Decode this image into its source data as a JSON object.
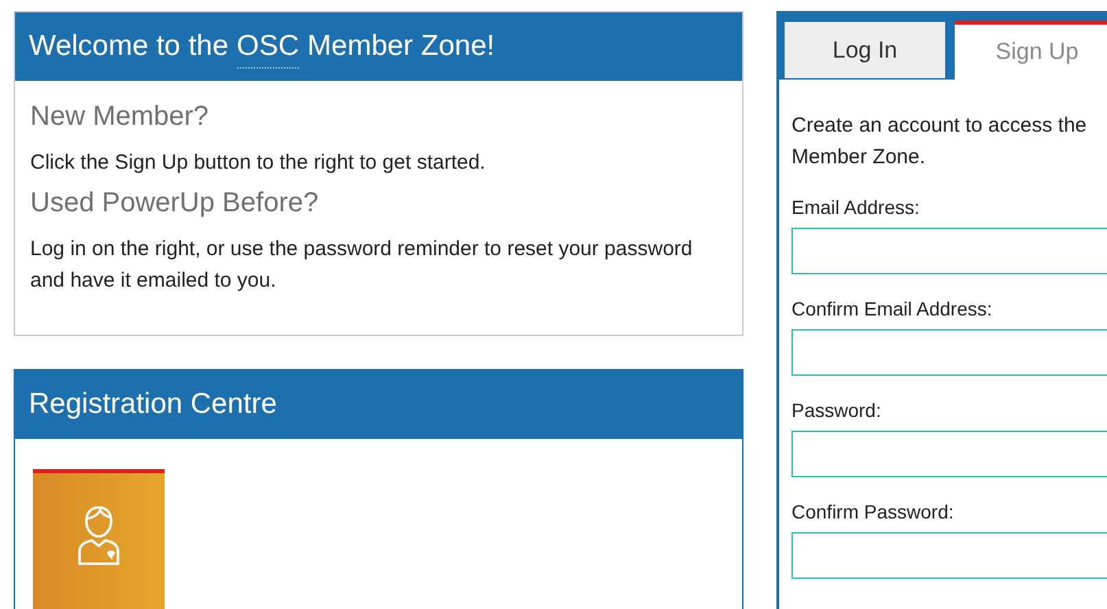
{
  "welcome_card": {
    "title_parts": [
      {
        "text": "Welcome to the",
        "kind": "plain"
      },
      {
        "text": "OSC",
        "kind": "abbr"
      },
      {
        "text": "Member Zone!",
        "kind": "plain"
      }
    ],
    "sections": [
      {
        "heading": "New Member?",
        "text": "Click the Sign Up button to the right to get started."
      },
      {
        "heading": "Used PowerUp Before?",
        "text": "Log in on the right, or use the password reminder to reset your password and have it emailed to you."
      }
    ]
  },
  "registration_card": {
    "title": "Registration Centre"
  },
  "account_panel": {
    "tabs": [
      {
        "label": "Log In",
        "selected": false
      },
      {
        "label": "Sign Up",
        "selected": true
      }
    ],
    "intro": "Create an account to access the Member Zone.",
    "fields": [
      {
        "label": "Email Address:"
      },
      {
        "label": "Confirm Email Address:"
      },
      {
        "label": "Password:"
      },
      {
        "label": "Confirm Password:"
      }
    ]
  }
}
